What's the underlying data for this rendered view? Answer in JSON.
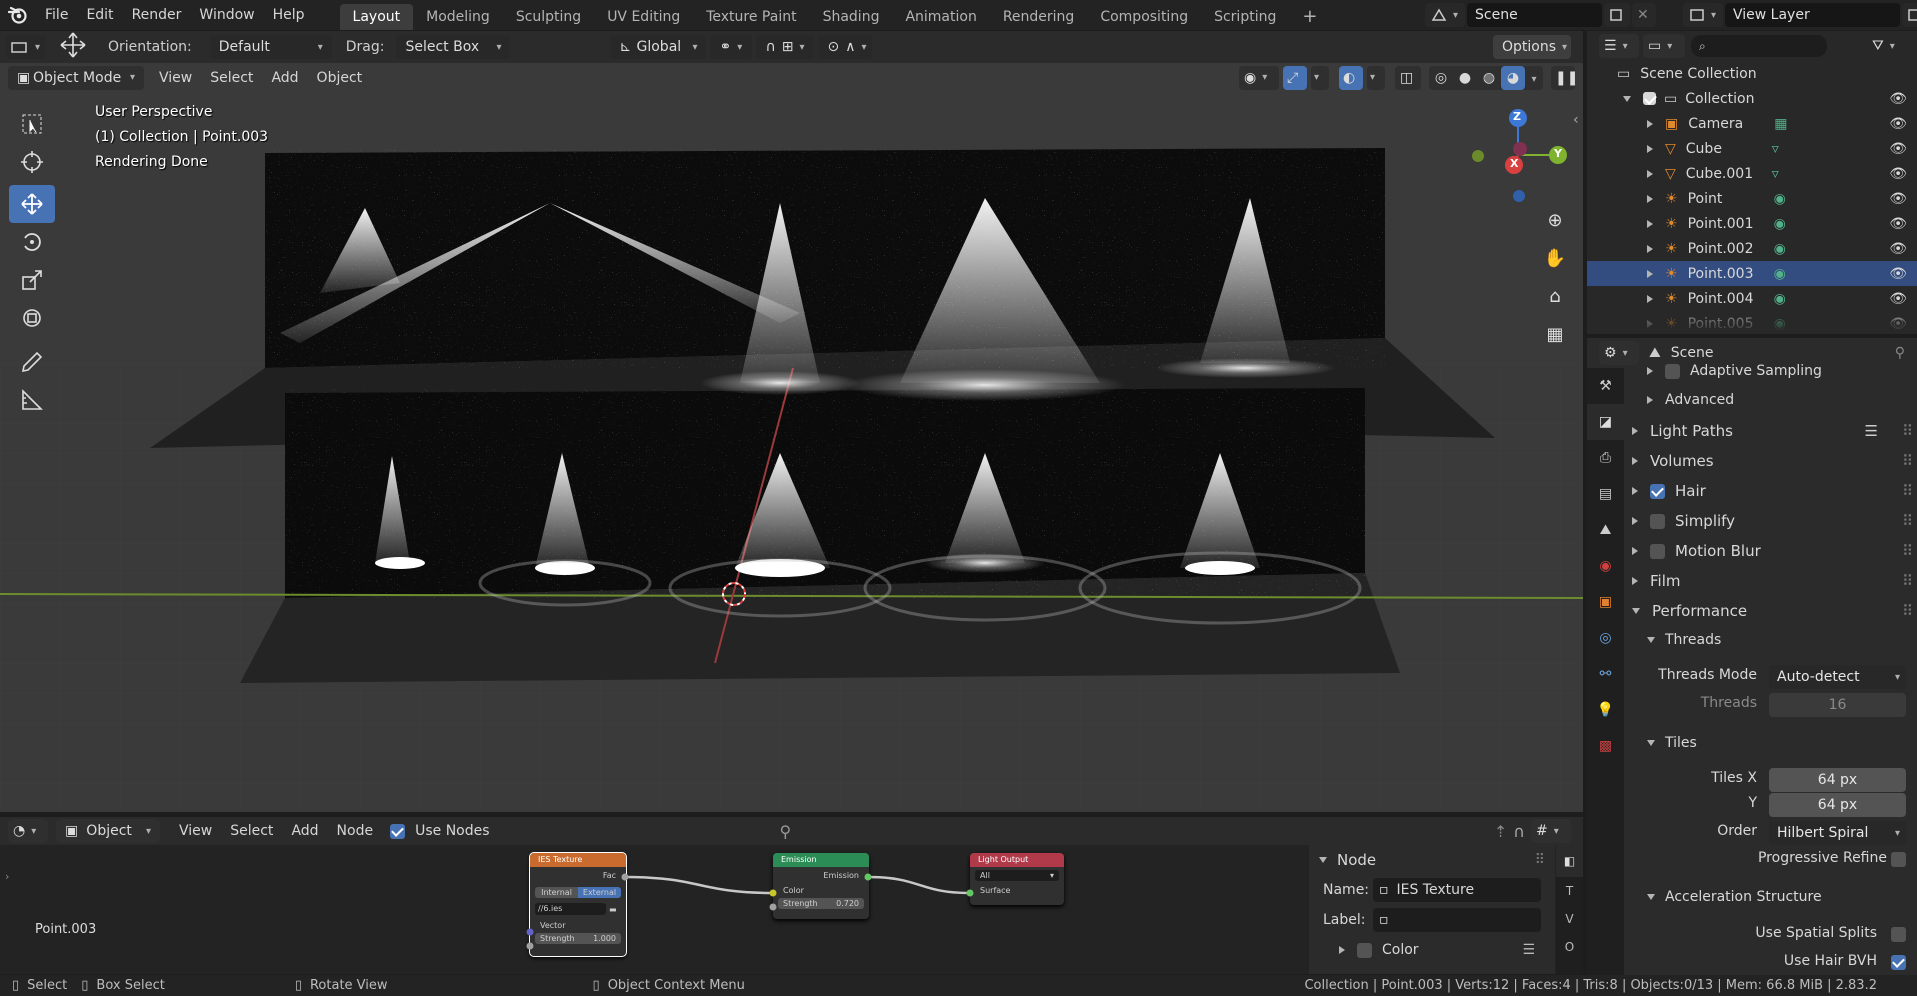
{
  "menu": {
    "items": [
      "File",
      "Edit",
      "Render",
      "Window",
      "Help"
    ],
    "workspaces": [
      "Layout",
      "Modeling",
      "Sculpting",
      "UV Editing",
      "Texture Paint",
      "Shading",
      "Animation",
      "Rendering",
      "Compositing",
      "Scripting"
    ],
    "active_workspace": "Layout",
    "add_tab": "+",
    "scene": "Scene",
    "view_layer": "View Layer"
  },
  "viewport_header": {
    "orientation_label": "Orientation:",
    "orientation_value": "Default",
    "drag_label": "Drag:",
    "drag_value": "Select Box",
    "transform_space": "Global",
    "options": "Options",
    "mode": "Object Mode",
    "menus": [
      "View",
      "Select",
      "Add",
      "Object"
    ]
  },
  "viewport": {
    "overlay_lines": [
      "User Perspective",
      "(1) Collection | Point.003",
      "Rendering Done"
    ],
    "axes": {
      "z": "Z",
      "y": "Y",
      "x": "X"
    },
    "tools": [
      "select-box-tool",
      "cursor-tool",
      "move-tool",
      "rotate-tool",
      "scale-tool",
      "transform-tool",
      "annotate-tool",
      "measure-tool"
    ],
    "active_tool": "move-tool"
  },
  "node_editor": {
    "type": "Object",
    "menus": [
      "View",
      "Select",
      "Add",
      "Node"
    ],
    "use_nodes_label": "Use Nodes",
    "use_nodes": true,
    "object_name": "Point.003",
    "nodes": {
      "ies": {
        "title": "IES Texture",
        "out": "Fac",
        "internal": "Internal",
        "external": "External",
        "file": "//6.ies",
        "vector": "Vector",
        "strength_label": "Strength",
        "strength": "1.000"
      },
      "emission": {
        "title": "Emission",
        "out": "Emission",
        "color": "Color",
        "strength_label": "Strength",
        "strength": "0.720"
      },
      "output": {
        "title": "Light Output",
        "target": "All",
        "surface": "Surface"
      }
    },
    "npanel": {
      "section": "Node",
      "name_label": "Name:",
      "name_value": "IES Texture",
      "label_label": "Label:",
      "label_value": "",
      "color_label": "Color"
    }
  },
  "outliner": {
    "root": "Scene Collection",
    "collection": "Collection",
    "items": [
      {
        "name": "Camera",
        "type": "camera"
      },
      {
        "name": "Cube",
        "type": "mesh"
      },
      {
        "name": "Cube.001",
        "type": "mesh"
      },
      {
        "name": "Point",
        "type": "light"
      },
      {
        "name": "Point.001",
        "type": "light"
      },
      {
        "name": "Point.002",
        "type": "light"
      },
      {
        "name": "Point.003",
        "type": "light"
      },
      {
        "name": "Point.004",
        "type": "light"
      },
      {
        "name": "Point.005",
        "type": "light"
      }
    ],
    "selected": "Point.003"
  },
  "properties": {
    "context": "Scene",
    "sections": [
      {
        "label": "Adaptive Sampling",
        "checkbox": false,
        "sub": true
      },
      {
        "label": "Advanced",
        "sub": true
      },
      {
        "label": "Light Paths"
      },
      {
        "label": "Volumes"
      },
      {
        "label": "Hair",
        "checkbox": true
      },
      {
        "label": "Simplify",
        "checkbox": false
      },
      {
        "label": "Motion Blur",
        "checkbox": false
      },
      {
        "label": "Film"
      },
      {
        "label": "Performance",
        "open": true
      }
    ],
    "threads": {
      "title": "Threads",
      "mode_label": "Threads Mode",
      "mode": "Auto-detect",
      "threads_label": "Threads",
      "threads": "16"
    },
    "tiles": {
      "title": "Tiles",
      "x_label": "Tiles X",
      "x": "64 px",
      "y_label": "Y",
      "y": "64 px",
      "order_label": "Order",
      "order": "Hilbert Spiral",
      "progressive_label": "Progressive Refine",
      "progressive": false
    },
    "accel": {
      "title": "Acceleration Structure",
      "spatial_label": "Use Spatial Splits",
      "spatial": false,
      "hair_bvh_label": "Use Hair BVH",
      "hair_bvh": true
    }
  },
  "status": {
    "select": "Select",
    "box_select": "Box Select",
    "rotate": "Rotate View",
    "context_menu": "Object Context Menu",
    "info": "Collection | Point.003 | Verts:12 | Faces:4 | Tris:8 | Objects:0/13 | Mem: 66.8 MiB | 2.83.2"
  }
}
